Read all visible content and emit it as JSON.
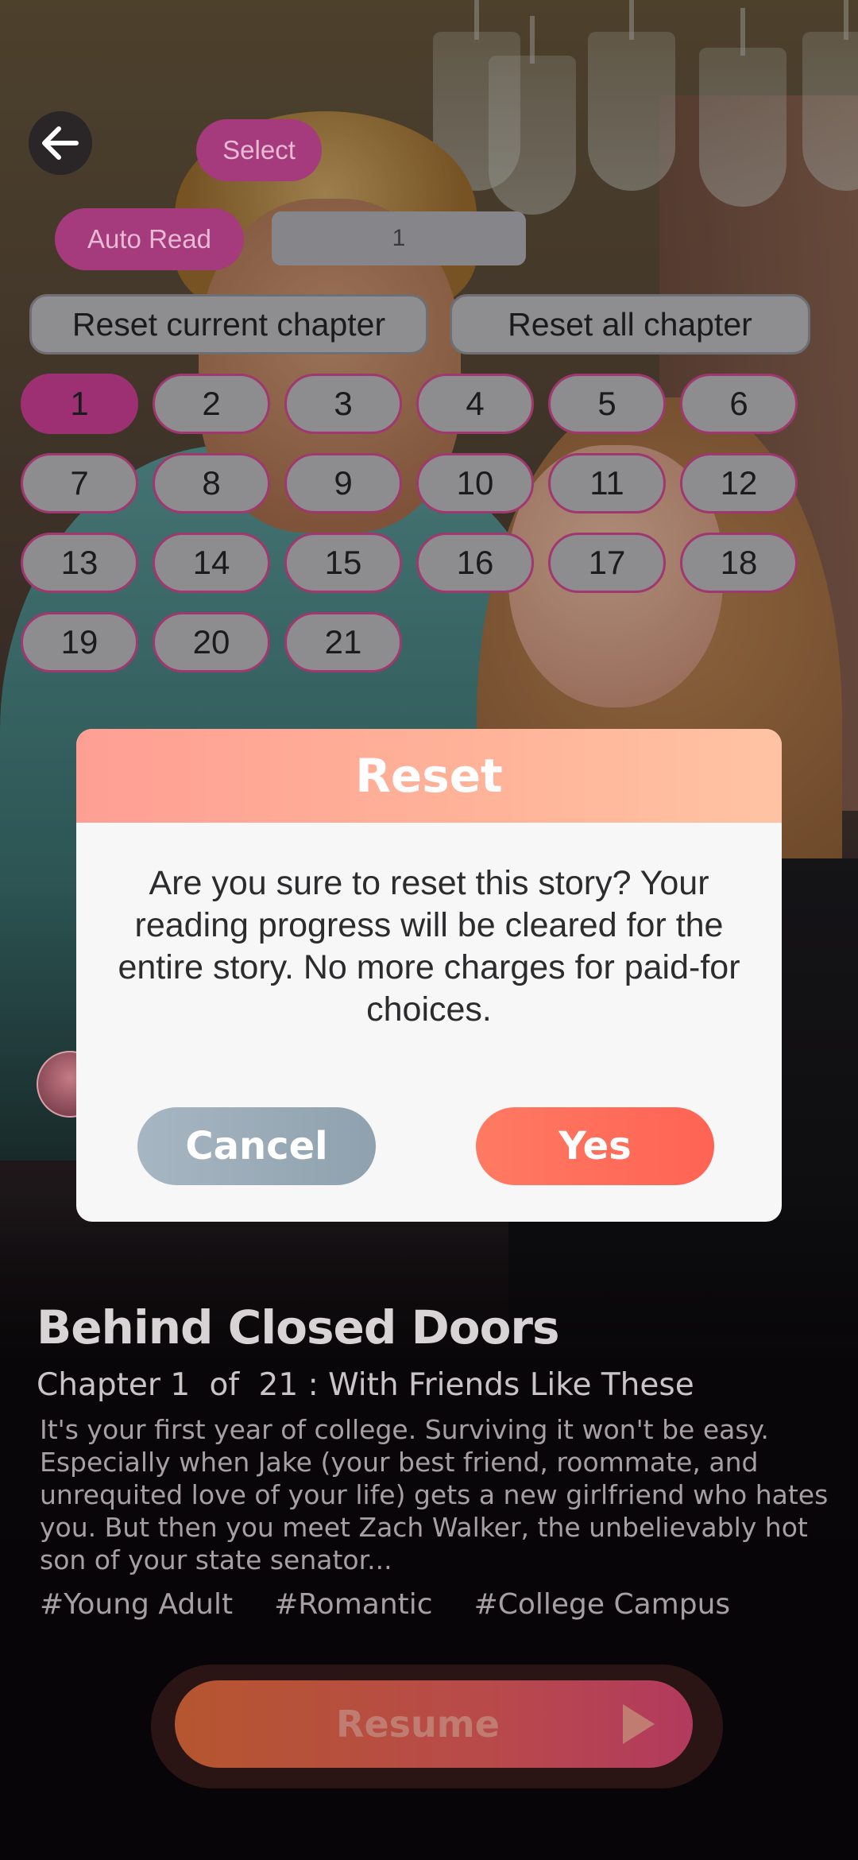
{
  "toolbar": {
    "back_icon": "arrow-left-icon",
    "select_label": "Select",
    "auto_read_label": "Auto Read",
    "chapter_input_value": "1",
    "reset_current_label": "Reset current chapter",
    "reset_all_label": "Reset all chapter"
  },
  "chapters": {
    "items": [
      "1",
      "2",
      "3",
      "4",
      "5",
      "6",
      "7",
      "8",
      "9",
      "10",
      "11",
      "12",
      "13",
      "14",
      "15",
      "16",
      "17",
      "18",
      "19",
      "20",
      "21"
    ],
    "selected": "1"
  },
  "dialog": {
    "title": "Reset",
    "message": "Are you sure to reset this story? Your reading progress will be cleared for the entire story. No more charges for paid-for choices.",
    "cancel_label": "Cancel",
    "yes_label": "Yes"
  },
  "story": {
    "title": "Behind Closed Doors",
    "chapter_prefix": "Chapter 1",
    "chapter_of": "of",
    "chapter_total": "21 : With Friends Like These",
    "synopsis": "It's your first year of college. Surviving it won't be easy. Especially when Jake (your best friend, roommate, and unrequited love of your life) gets a new girlfriend who hates you. But then you meet Zach Walker, the unbelievably hot son of your state senator...",
    "tags": [
      "#Young Adult",
      "#Romantic",
      "#College Campus"
    ],
    "resume_label": "Resume",
    "resume_icon": "play-icon"
  },
  "colors": {
    "magenta": "#a53a7c",
    "dialog_header": "#ffb499",
    "yes": "#ff6354",
    "cancel": "#9aabb8"
  }
}
